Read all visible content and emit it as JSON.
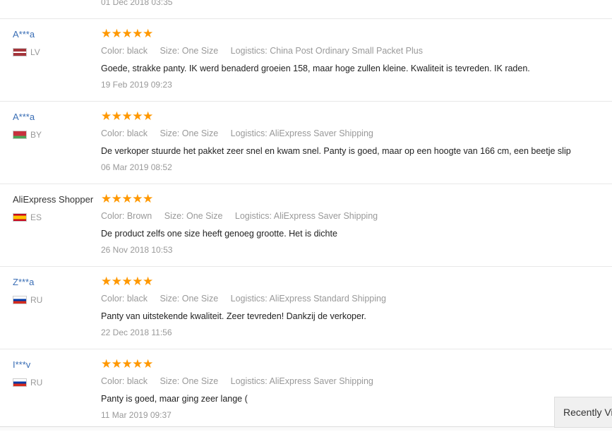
{
  "top_partial_date": "01 Dec 2018 03:35",
  "labels": {
    "color_prefix": "Color:",
    "size_prefix": "Size:",
    "logistics_prefix": "Logistics:"
  },
  "reviews": [
    {
      "user": "A***a",
      "country_code": "LV",
      "stars": "★★★★★",
      "color": "Color: black",
      "size": "Size: One Size",
      "logistics": "Logistics: China Post Ordinary Small Packet Plus",
      "text": "Goede, strakke panty. IK werd benaderd groeien 158, maar hoge zullen kleine. Kwaliteit is tevreden. IK raden.",
      "date": "19 Feb 2019 09:23",
      "flag_colors": [
        "#a4343a",
        "#ffffff",
        "#a4343a"
      ]
    },
    {
      "user": "A***a",
      "country_code": "BY",
      "stars": "★★★★★",
      "color": "Color: black",
      "size": "Size: One Size",
      "logistics": "Logistics: AliExpress Saver Shipping",
      "text": "De verkoper stuurde het pakket zeer snel en kwam snel. Panty is goed, maar op een hoogte van 166 cm, een beetje slip",
      "date": "06 Mar 2019 08:52",
      "flag_colors": [
        "#c8313e",
        "#c8313e",
        "#4aa657"
      ]
    },
    {
      "user": "AliExpress Shopper",
      "country_code": "ES",
      "stars": "★★★★★",
      "color": "Color: Brown",
      "size": "Size: One Size",
      "logistics": "Logistics: AliExpress Saver Shipping",
      "text": "De product zelfs one size heeft genoeg grootte. Het is dichte",
      "date": "26 Nov 2018 10:53",
      "flag_colors": [
        "#c60b1e",
        "#ffc400",
        "#c60b1e"
      ]
    },
    {
      "user": "Z***a",
      "country_code": "RU",
      "stars": "★★★★★",
      "color": "Color: black",
      "size": "Size: One Size",
      "logistics": "Logistics: AliExpress Standard Shipping",
      "text": "Panty van uitstekende kwaliteit. Zeer tevreden! Dankzij de verkoper.",
      "date": "22 Dec 2018 11:56",
      "flag_colors": [
        "#ffffff",
        "#0039a6",
        "#d52b1e"
      ]
    },
    {
      "user": "I***v",
      "country_code": "RU",
      "stars": "★★★★★",
      "color": "Color: black",
      "size": "Size: One Size",
      "logistics": "Logistics: AliExpress Saver Shipping",
      "text": "Panty is goed, maar ging zeer lange (",
      "date": "11 Mar 2019 09:37",
      "flag_colors": [
        "#ffffff",
        "#0039a6",
        "#d52b1e"
      ]
    }
  ],
  "recently_viewed": "Recently Viewed",
  "colors": {
    "star": "#ff9800",
    "user_link": "#3a6eb5",
    "muted": "#999999"
  }
}
